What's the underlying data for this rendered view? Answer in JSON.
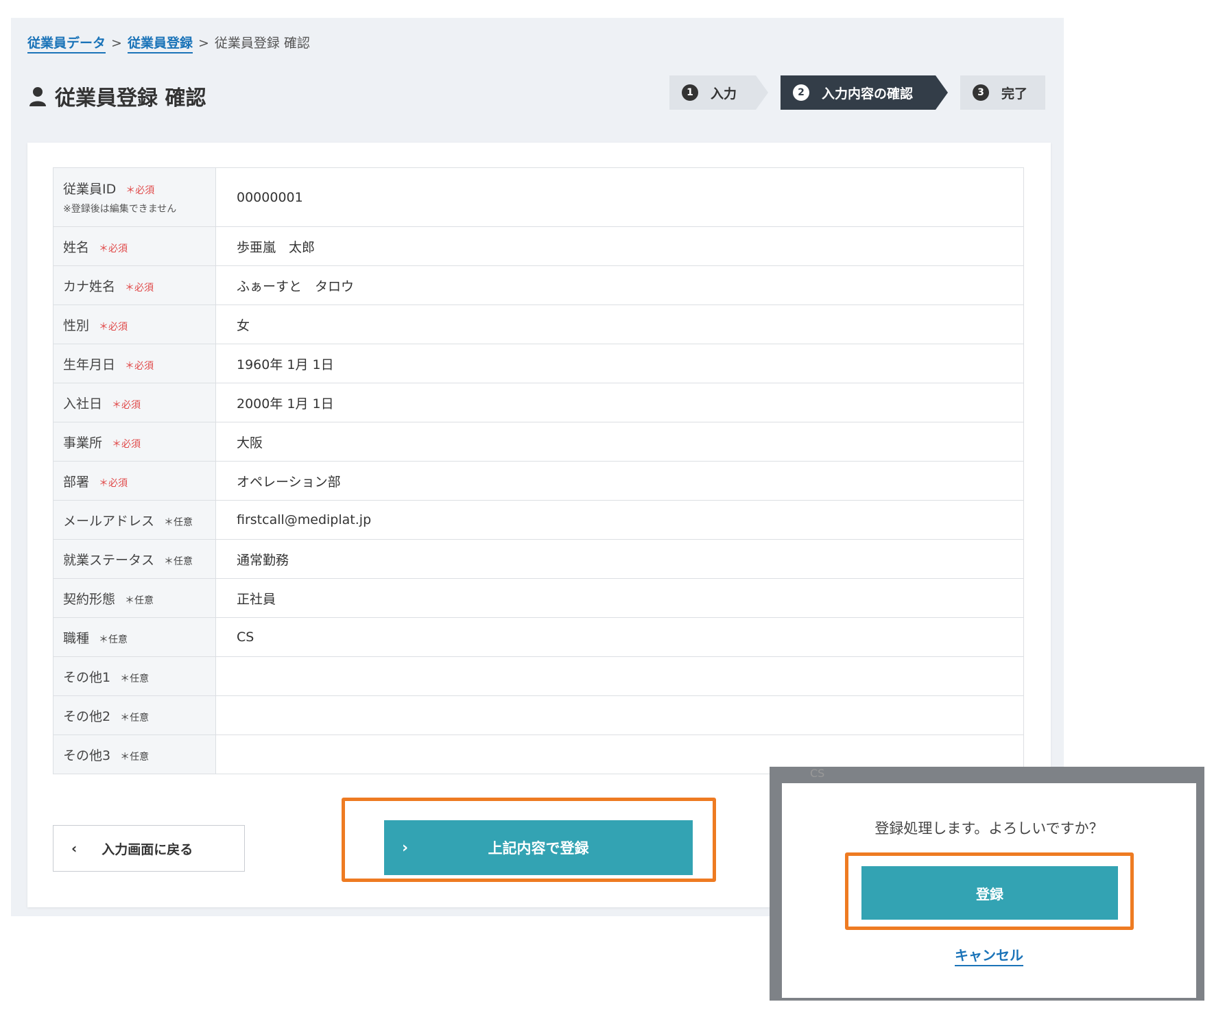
{
  "breadcrumb": {
    "items": [
      "従業員データ",
      "従業員登録",
      "従業員登録 確認"
    ],
    "separator": ">"
  },
  "header": {
    "title": "従業員登録 確認",
    "icon": "user-icon"
  },
  "steps": [
    {
      "num": "1",
      "label": "入力"
    },
    {
      "num": "2",
      "label": "入力内容の確認"
    },
    {
      "num": "3",
      "label": "完了"
    }
  ],
  "form": {
    "rows": [
      {
        "label": "従業員ID",
        "tag": "＊必須",
        "note": "※登録後は編集できません",
        "value": "00000001"
      },
      {
        "label": "姓名",
        "tag": "＊必須",
        "value": "歩亜嵐　太郎"
      },
      {
        "label": "カナ姓名",
        "tag": "＊必須",
        "value": "ふぁーすと　タロウ"
      },
      {
        "label": "性別",
        "tag": "＊必須",
        "value": "女"
      },
      {
        "label": "生年月日",
        "tag": "＊必須",
        "value": "1960年 1月 1日"
      },
      {
        "label": "入社日",
        "tag": "＊必須",
        "value": "2000年 1月 1日"
      },
      {
        "label": "事業所",
        "tag": "＊必須",
        "value": "大阪"
      },
      {
        "label": "部署",
        "tag": "＊必須",
        "value": "オペレーション部"
      },
      {
        "label": "メールアドレス",
        "tag": "＊任意",
        "value": "firstcall@mediplat.jp"
      },
      {
        "label": "就業ステータス",
        "tag": "＊任意",
        "value": "通常勤務"
      },
      {
        "label": "契約形態",
        "tag": "＊任意",
        "value": "正社員"
      },
      {
        "label": "職種",
        "tag": "＊任意",
        "value": "CS"
      },
      {
        "label": "その他1",
        "tag": "＊任意",
        "value": ""
      },
      {
        "label": "その他2",
        "tag": "＊任意",
        "value": ""
      },
      {
        "label": "その他3",
        "tag": "＊任意",
        "value": ""
      }
    ]
  },
  "actions": {
    "back_label": "入力画面に戻る",
    "submit_label": "上記内容で登録"
  },
  "modal": {
    "background_text": "CS",
    "message": "登録処理します。よろしいですか？",
    "register_label": "登録",
    "cancel_label": "キャンセル"
  },
  "colors": {
    "accent": "#33a3b3",
    "highlight": "#ee7b22",
    "link": "#1a73b8",
    "required": "#e04848",
    "step_active": "#333d48"
  }
}
